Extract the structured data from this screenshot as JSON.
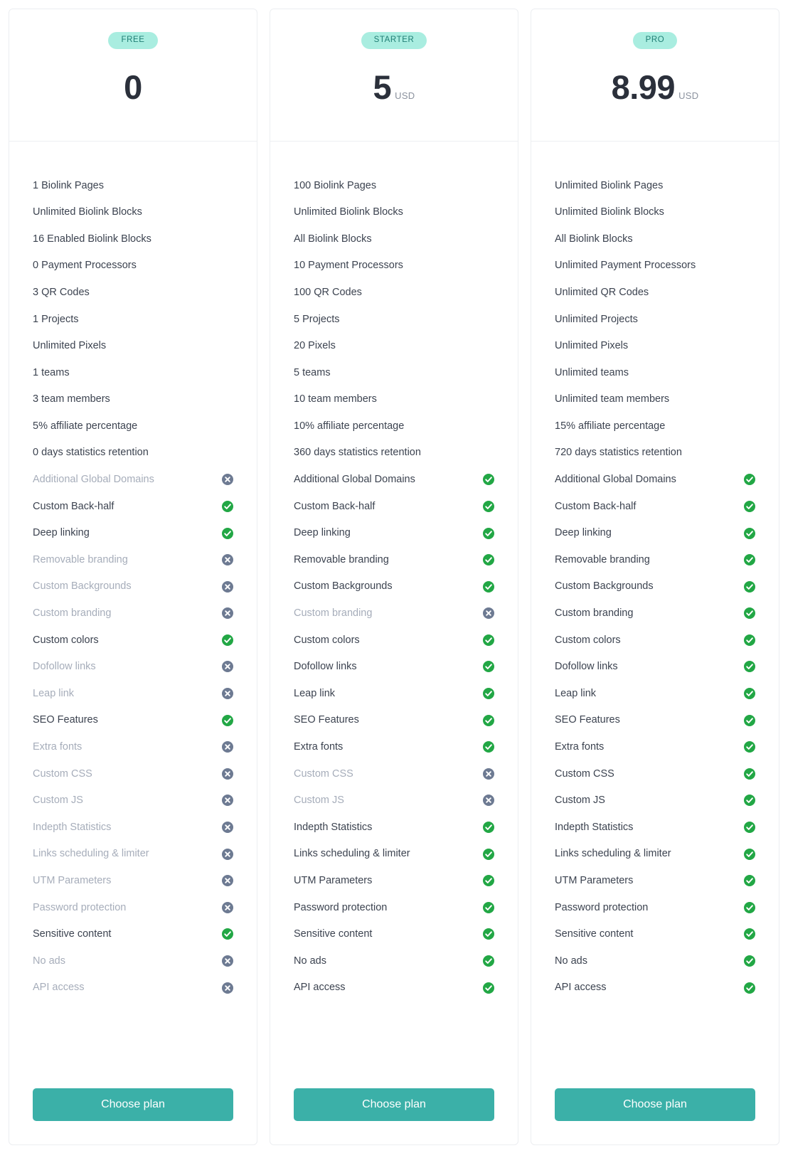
{
  "icons": {
    "check": "check-circle-icon",
    "cross": "times-circle-icon"
  },
  "colors": {
    "badge_bg": "#a9ede0",
    "badge_text": "#1f7e74",
    "button_bg": "#3bb0a8",
    "yes_icon": "#22a745",
    "no_icon": "#6d7a92",
    "enabled_text": "#3c4350",
    "disabled_text": "#a6adba",
    "card_border": "#eceef1"
  },
  "plans": [
    {
      "badge": "FREE",
      "price": "0",
      "currency": "",
      "cta": "Choose plan",
      "features": [
        {
          "label": "1 Biolink Pages",
          "type": "text"
        },
        {
          "label": "Unlimited Biolink Blocks",
          "type": "text"
        },
        {
          "label": "16 Enabled Biolink Blocks",
          "type": "text"
        },
        {
          "label": "0 Payment Processors",
          "type": "text"
        },
        {
          "label": "3 QR Codes",
          "type": "text"
        },
        {
          "label": "1 Projects",
          "type": "text"
        },
        {
          "label": "Unlimited Pixels",
          "type": "text"
        },
        {
          "label": "1 teams",
          "type": "text"
        },
        {
          "label": "3 team members",
          "type": "text"
        },
        {
          "label": "5% affiliate percentage",
          "type": "text"
        },
        {
          "label": "0 days statistics retention",
          "type": "text"
        },
        {
          "label": "Additional Global Domains",
          "type": "bool",
          "enabled": false
        },
        {
          "label": "Custom Back-half",
          "type": "bool",
          "enabled": true
        },
        {
          "label": "Deep linking",
          "type": "bool",
          "enabled": true
        },
        {
          "label": "Removable branding",
          "type": "bool",
          "enabled": false
        },
        {
          "label": "Custom Backgrounds",
          "type": "bool",
          "enabled": false
        },
        {
          "label": "Custom branding",
          "type": "bool",
          "enabled": false
        },
        {
          "label": "Custom colors",
          "type": "bool",
          "enabled": true
        },
        {
          "label": "Dofollow links",
          "type": "bool",
          "enabled": false
        },
        {
          "label": "Leap link",
          "type": "bool",
          "enabled": false
        },
        {
          "label": "SEO Features",
          "type": "bool",
          "enabled": true
        },
        {
          "label": "Extra fonts",
          "type": "bool",
          "enabled": false
        },
        {
          "label": "Custom CSS",
          "type": "bool",
          "enabled": false
        },
        {
          "label": "Custom JS",
          "type": "bool",
          "enabled": false
        },
        {
          "label": "Indepth Statistics",
          "type": "bool",
          "enabled": false
        },
        {
          "label": "Links scheduling & limiter",
          "type": "bool",
          "enabled": false
        },
        {
          "label": "UTM Parameters",
          "type": "bool",
          "enabled": false
        },
        {
          "label": "Password protection",
          "type": "bool",
          "enabled": false
        },
        {
          "label": "Sensitive content",
          "type": "bool",
          "enabled": true
        },
        {
          "label": "No ads",
          "type": "bool",
          "enabled": false
        },
        {
          "label": "API access",
          "type": "bool",
          "enabled": false
        }
      ]
    },
    {
      "badge": "STARTER",
      "price": "5",
      "currency": "USD",
      "cta": "Choose plan",
      "features": [
        {
          "label": "100 Biolink Pages",
          "type": "text"
        },
        {
          "label": "Unlimited Biolink Blocks",
          "type": "text"
        },
        {
          "label": "All Biolink Blocks",
          "type": "text"
        },
        {
          "label": "10 Payment Processors",
          "type": "text"
        },
        {
          "label": "100 QR Codes",
          "type": "text"
        },
        {
          "label": "5 Projects",
          "type": "text"
        },
        {
          "label": "20 Pixels",
          "type": "text"
        },
        {
          "label": "5 teams",
          "type": "text"
        },
        {
          "label": "10 team members",
          "type": "text"
        },
        {
          "label": "10% affiliate percentage",
          "type": "text"
        },
        {
          "label": "360 days statistics retention",
          "type": "text"
        },
        {
          "label": "Additional Global Domains",
          "type": "bool",
          "enabled": true
        },
        {
          "label": "Custom Back-half",
          "type": "bool",
          "enabled": true
        },
        {
          "label": "Deep linking",
          "type": "bool",
          "enabled": true
        },
        {
          "label": "Removable branding",
          "type": "bool",
          "enabled": true
        },
        {
          "label": "Custom Backgrounds",
          "type": "bool",
          "enabled": true
        },
        {
          "label": "Custom branding",
          "type": "bool",
          "enabled": false
        },
        {
          "label": "Custom colors",
          "type": "bool",
          "enabled": true
        },
        {
          "label": "Dofollow links",
          "type": "bool",
          "enabled": true
        },
        {
          "label": "Leap link",
          "type": "bool",
          "enabled": true
        },
        {
          "label": "SEO Features",
          "type": "bool",
          "enabled": true
        },
        {
          "label": "Extra fonts",
          "type": "bool",
          "enabled": true
        },
        {
          "label": "Custom CSS",
          "type": "bool",
          "enabled": false
        },
        {
          "label": "Custom JS",
          "type": "bool",
          "enabled": false
        },
        {
          "label": "Indepth Statistics",
          "type": "bool",
          "enabled": true
        },
        {
          "label": "Links scheduling & limiter",
          "type": "bool",
          "enabled": true
        },
        {
          "label": "UTM Parameters",
          "type": "bool",
          "enabled": true
        },
        {
          "label": "Password protection",
          "type": "bool",
          "enabled": true
        },
        {
          "label": "Sensitive content",
          "type": "bool",
          "enabled": true
        },
        {
          "label": "No ads",
          "type": "bool",
          "enabled": true
        },
        {
          "label": "API access",
          "type": "bool",
          "enabled": true
        }
      ]
    },
    {
      "badge": "PRO",
      "price": "8.99",
      "currency": "USD",
      "cta": "Choose plan",
      "features": [
        {
          "label": "Unlimited Biolink Pages",
          "type": "text"
        },
        {
          "label": "Unlimited Biolink Blocks",
          "type": "text"
        },
        {
          "label": "All Biolink Blocks",
          "type": "text"
        },
        {
          "label": "Unlimited Payment Processors",
          "type": "text"
        },
        {
          "label": "Unlimited QR Codes",
          "type": "text"
        },
        {
          "label": "Unlimited Projects",
          "type": "text"
        },
        {
          "label": "Unlimited Pixels",
          "type": "text"
        },
        {
          "label": "Unlimited teams",
          "type": "text"
        },
        {
          "label": "Unlimited team members",
          "type": "text"
        },
        {
          "label": "15% affiliate percentage",
          "type": "text"
        },
        {
          "label": "720 days statistics retention",
          "type": "text"
        },
        {
          "label": "Additional Global Domains",
          "type": "bool",
          "enabled": true
        },
        {
          "label": "Custom Back-half",
          "type": "bool",
          "enabled": true
        },
        {
          "label": "Deep linking",
          "type": "bool",
          "enabled": true
        },
        {
          "label": "Removable branding",
          "type": "bool",
          "enabled": true
        },
        {
          "label": "Custom Backgrounds",
          "type": "bool",
          "enabled": true
        },
        {
          "label": "Custom branding",
          "type": "bool",
          "enabled": true
        },
        {
          "label": "Custom colors",
          "type": "bool",
          "enabled": true
        },
        {
          "label": "Dofollow links",
          "type": "bool",
          "enabled": true
        },
        {
          "label": "Leap link",
          "type": "bool",
          "enabled": true
        },
        {
          "label": "SEO Features",
          "type": "bool",
          "enabled": true
        },
        {
          "label": "Extra fonts",
          "type": "bool",
          "enabled": true
        },
        {
          "label": "Custom CSS",
          "type": "bool",
          "enabled": true
        },
        {
          "label": "Custom JS",
          "type": "bool",
          "enabled": true
        },
        {
          "label": "Indepth Statistics",
          "type": "bool",
          "enabled": true
        },
        {
          "label": "Links scheduling & limiter",
          "type": "bool",
          "enabled": true
        },
        {
          "label": "UTM Parameters",
          "type": "bool",
          "enabled": true
        },
        {
          "label": "Password protection",
          "type": "bool",
          "enabled": true
        },
        {
          "label": "Sensitive content",
          "type": "bool",
          "enabled": true
        },
        {
          "label": "No ads",
          "type": "bool",
          "enabled": true
        },
        {
          "label": "API access",
          "type": "bool",
          "enabled": true
        }
      ]
    }
  ]
}
